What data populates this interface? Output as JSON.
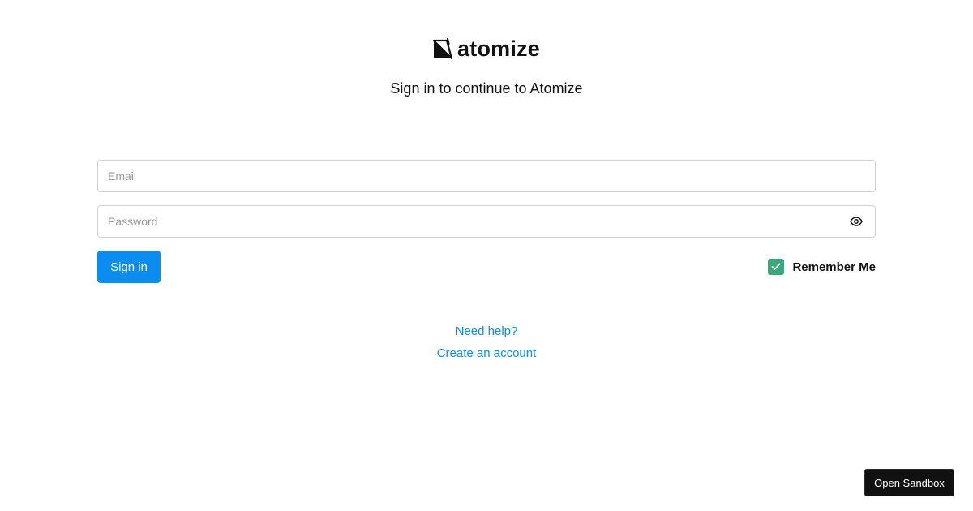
{
  "brand": {
    "name": "atomize",
    "logo_icon": "atomize-logo-mark"
  },
  "header": {
    "subtitle": "Sign in to continue to Atomize"
  },
  "form": {
    "email": {
      "value": "",
      "placeholder": "Email"
    },
    "password": {
      "value": "",
      "placeholder": "Password",
      "toggle_icon": "eye-icon"
    },
    "signin_label": "Sign in",
    "remember_label": "Remember Me",
    "remember_checked": true
  },
  "links": {
    "help": "Need help?",
    "create_account": "Create an account"
  },
  "sandbox": {
    "label": "Open Sandbox"
  },
  "colors": {
    "accent": "#0a8cf0",
    "checkbox": "#3aa87a",
    "sandbox_bg": "#111111"
  }
}
